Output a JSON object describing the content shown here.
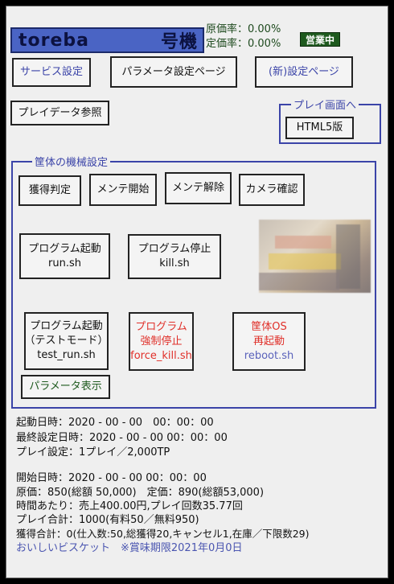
{
  "title_bar": {
    "left": "toreba",
    "right": "号機"
  },
  "rates": {
    "cost_rate": "原価率：0.00%",
    "fixed_rate": "定価率：0.00%",
    "status_badge": "営業中"
  },
  "top_buttons": {
    "service_settings": "サービス設定",
    "parameter_settings": "パラメータ設定ページ",
    "new_settings": "(新)設定ページ",
    "play_data": "プレイデータ参照"
  },
  "play_screen": {
    "legend": "プレイ画面へ",
    "html5": "HTML5版"
  },
  "machine_settings": {
    "legend": "筐体の機械設定",
    "acquire_judge": "獲得判定",
    "maintenance_start": "メンテ開始",
    "maintenance_end": "メンテ解除",
    "camera_check": "カメラ確認",
    "program_start": {
      "line1": "プログラム起動",
      "line2": "run.sh"
    },
    "program_stop": {
      "line1": "プログラム停止",
      "line2": "kill.sh"
    },
    "program_test": {
      "line1": "プログラム起動",
      "line2": "（テストモード）",
      "line3": "test_run.sh"
    },
    "program_force": {
      "line1": "プログラム",
      "line2": "強制停止",
      "line3": "force_kill.sh"
    },
    "os_reboot": {
      "line1": "筐体OS",
      "line2": "再起動",
      "line3": "reboot.sh"
    },
    "show_params": "パラメータ表示"
  },
  "info": {
    "start_datetime": "起動日時：2020 - 00 - 00　00：00：00",
    "last_set_datetime": "最終設定日時：2020 - 00 - 00 00：00：00",
    "play_setting": "プレイ設定：1プレイ／2,000TP",
    "open_datetime": "開始日時：2020 - 00 - 00 00：00：00",
    "price": "原価：850(総額 50,000)　定価：890(総額53,000)",
    "per_hour": "時間あたり：売上400.00円,プレイ回数35.77回",
    "play_total": "プレイ合計：1000(有料50／無料950)",
    "acquire_total": "獲得合計：0(仕入数:50,総獲得20,キャンセル1,在庫／下限数29)",
    "prize": "おいしいビスケット　※賞味期限2021年0月0日"
  },
  "colors": {
    "title_bg": "#4a64c4",
    "accent_blue": "#3b44a8",
    "danger_red": "#e0302a",
    "status_green": "#1e5a1e"
  }
}
